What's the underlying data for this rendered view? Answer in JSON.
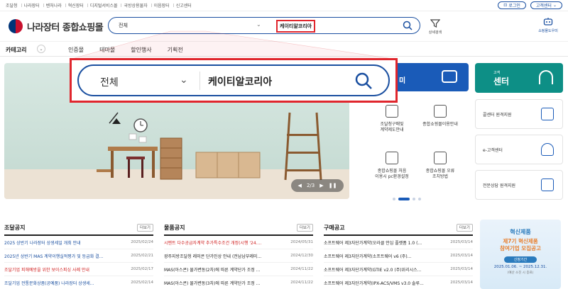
{
  "top_links": [
    "조달청",
    "나라장터",
    "벤처나라",
    "혁신장터",
    "디지털서비스몰",
    "국방상용물자",
    "이음장터",
    "신고센터"
  ],
  "top_right": {
    "login": "로그인",
    "customer": "고객센터"
  },
  "brand": {
    "logo_text": "나라장터 종합쇼핑몰"
  },
  "search": {
    "scope": "전체",
    "query": "케이티알코리아"
  },
  "header_buttons": {
    "filter": "상세검색",
    "helper": "쇼핑몰도우미"
  },
  "category": {
    "label": "카테고리",
    "menu": [
      "인증몰",
      "테마몰",
      "할인행사",
      "기획전"
    ]
  },
  "hero": {
    "page": "2/3"
  },
  "guide": {
    "title_fragment": "미",
    "items": [
      {
        "label": "조달청구매및\n계약제도안내"
      },
      {
        "label": "종합쇼핑몰이용안내"
      },
      {
        "label": "종합쇼핑몰 처음\n이용시 pc환경설정"
      },
      {
        "label": "종합쇼핑몰 오류\n조치방법"
      }
    ]
  },
  "customer_center": {
    "small": "고객",
    "big": "센터",
    "items": [
      "콜센터 원격지원",
      "e-고객센터",
      "전문상담 원격지원"
    ]
  },
  "notices": [
    {
      "title": "조달공지",
      "more": "더보기",
      "rows": [
        {
          "t": "2025 상반기 나라장터 상생세일 개최 안내",
          "d": "2025/02/24",
          "c": "blue"
        },
        {
          "t": "2025년 상반기 MAS 계약이행실적평가 및 등급화 결...",
          "d": "2025/02/21",
          "c": "blue"
        },
        {
          "t": "조달기업 피해예방을 위한 보이스피싱 사례 안내",
          "d": "2025/02/17",
          "c": "red"
        },
        {
          "t": "조달기업 전통문화상품(공예품) 나라장터 상생세...",
          "d": "2025/02/14",
          "c": "blue"
        }
      ]
    },
    {
      "title": "물품공지",
      "more": "더보기",
      "rows": [
        {
          "t": "시멘트 다수공급자계약 추가특수조건 개정(시행 '24....",
          "d": "2024/05/31",
          "c": "red"
        },
        {
          "t": "광주지방조달청 레미콘 단가인상 안내 (전남남부레미...",
          "d": "2024/12/30",
          "c": ""
        },
        {
          "t": "MAS(아스콘) 물가변동(2차)에 따른 계약단가 조정 ...",
          "d": "2024/11/22",
          "c": ""
        },
        {
          "t": "MAS(아스콘) 물가변동(3차)에 따른 계약단가 조정 ...",
          "d": "2024/11/22",
          "c": ""
        }
      ]
    },
    {
      "title": "구매공고",
      "more": "더보기",
      "rows": [
        {
          "t": "소프트웨어 제3자단가계약(오라클 안심 플랫폼 1.0 (...",
          "d": "2025/03/14",
          "c": ""
        },
        {
          "t": "소프트웨어 제3자단가계약(소프트웨어 v6 (주)...",
          "d": "2025/03/14",
          "c": ""
        },
        {
          "t": "소프트웨어 제3자단가계약(GTIE v2.0 (주)위리시스...",
          "d": "2025/03/14",
          "c": ""
        },
        {
          "t": "소프트웨어 제3자단가계약(IPX-ACS/VMS v3.0 솔루...",
          "d": "2025/03/14",
          "c": ""
        }
      ]
    }
  ],
  "promo": {
    "line1": "혁신제품",
    "line2": "제7기 혁신제품\n참여기업 모집공고",
    "badge": "신청기간",
    "dates": "2025.01.06. ~ 2025.12.31.",
    "note": "(예산 소진 시 종료)"
  },
  "colors": {
    "brand_blue": "#1a4fa0",
    "highlight_red": "#e0262d",
    "teal": "#0d8f86"
  }
}
